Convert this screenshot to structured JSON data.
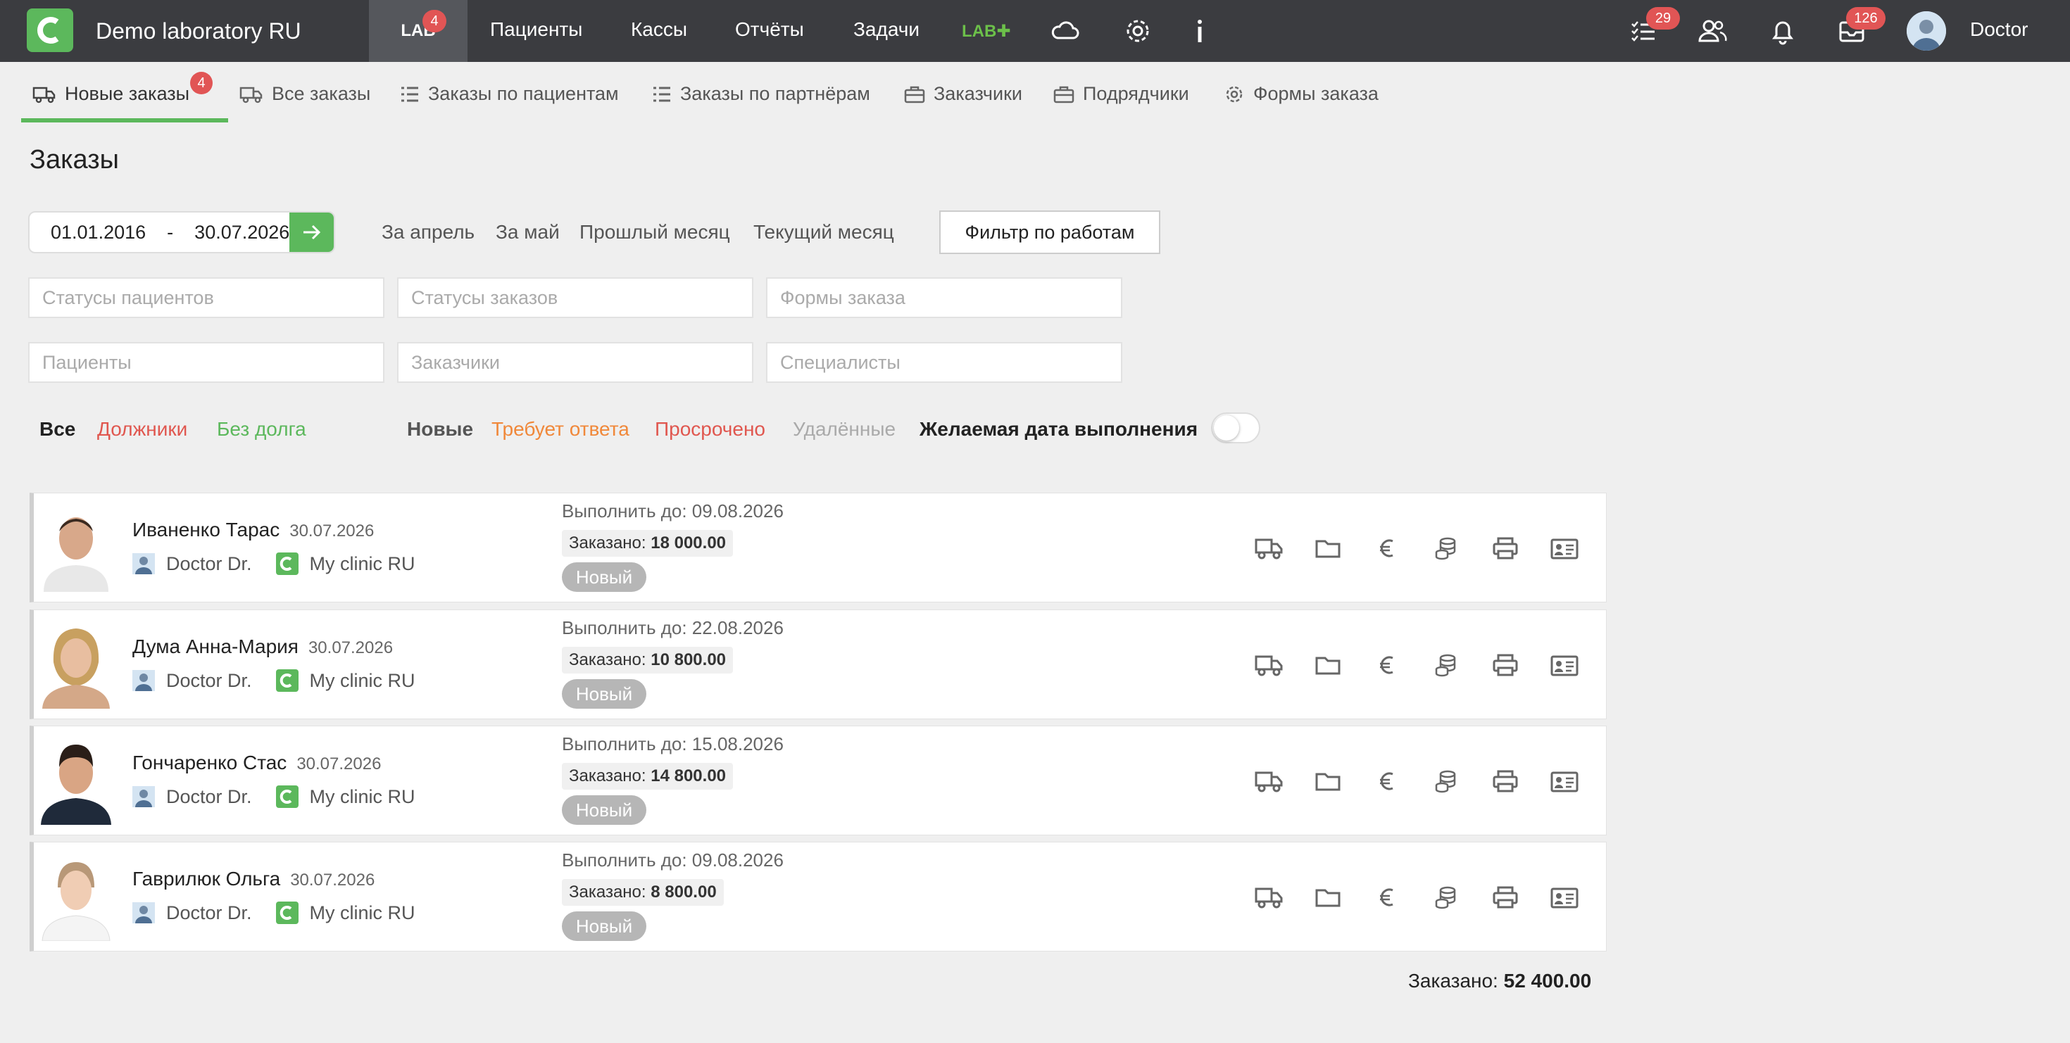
{
  "app": {
    "title": "Demo laboratory RU"
  },
  "nav": {
    "lab_label": "LAB",
    "lab_badge": "4",
    "items": [
      "Пациенты",
      "Кассы",
      "Отчёты",
      "Задачи"
    ],
    "labplus": "LAB✚"
  },
  "top_right": {
    "tasks_badge": "29",
    "messages_badge": "126",
    "user": "Doctor"
  },
  "tabs": [
    {
      "label": "Новые заказы",
      "icon": "truck-icon",
      "badge": "4",
      "active": true
    },
    {
      "label": "Все заказы",
      "icon": "truck-icon"
    },
    {
      "label": "Заказы по пациентам",
      "icon": "list-icon"
    },
    {
      "label": "Заказы по партнёрам",
      "icon": "list-icon"
    },
    {
      "label": "Заказчики",
      "icon": "briefcase-icon"
    },
    {
      "label": "Подрядчики",
      "icon": "briefcase-icon"
    },
    {
      "label": "Формы заказа",
      "icon": "gear-icon"
    }
  ],
  "page_title": "Заказы",
  "date_range": {
    "from": "01.01.2016",
    "separator": "-",
    "to": "30.07.2026"
  },
  "quick_filters": [
    "За апрель",
    "За май",
    "Прошлый месяц",
    "Текущий месяц"
  ],
  "filter_button": "Фильтр по работам",
  "inputs": {
    "patient_status": "Статусы пациентов",
    "order_status": "Статусы заказов",
    "order_forms": "Формы заказа",
    "patients": "Пациенты",
    "customers": "Заказчики",
    "specialists": "Специалисты"
  },
  "debt_filters": {
    "all": "Все",
    "debtors": "Должники",
    "no_debt": "Без долга"
  },
  "status_filters": {
    "new": "Новые",
    "needs_reply": "Требует ответа",
    "overdue": "Просрочено",
    "deleted": "Удалённые"
  },
  "desired_date_label": "Желаемая дата выполнения",
  "desired_date_toggle": false,
  "orders": [
    {
      "name": "Иваненко Тарас",
      "date": "30.07.2026",
      "doctor": "Doctor Dr.",
      "clinic": "My clinic RU",
      "deadline": "Выполнить до: 09.08.2026",
      "ordered_label": "Заказано:",
      "amount": "18 000.00",
      "status": "Новый"
    },
    {
      "name": "Дума Анна-Мария",
      "date": "30.07.2026",
      "doctor": "Doctor Dr.",
      "clinic": "My clinic RU",
      "deadline": "Выполнить до: 22.08.2026",
      "ordered_label": "Заказано:",
      "amount": "10 800.00",
      "status": "Новый"
    },
    {
      "name": "Гончаренко Стас",
      "date": "30.07.2026",
      "doctor": "Doctor Dr.",
      "clinic": "My clinic RU",
      "deadline": "Выполнить до: 15.08.2026",
      "ordered_label": "Заказано:",
      "amount": "14 800.00",
      "status": "Новый"
    },
    {
      "name": "Гаврилюк Ольга",
      "date": "30.07.2026",
      "doctor": "Doctor Dr.",
      "clinic": "My clinic RU",
      "deadline": "Выполнить до: 09.08.2026",
      "ordered_label": "Заказано:",
      "amount": "8 800.00",
      "status": "Новый"
    }
  ],
  "total": {
    "label": "Заказано:",
    "amount": "52 400.00"
  },
  "colors": {
    "accent": "#5cb85c",
    "topbar": "#3b3c40",
    "badge": "#e15555",
    "debtors": "#e0574f",
    "no_debt": "#5cb85c",
    "needs_reply": "#f0883a",
    "overdue": "#e0574f"
  }
}
